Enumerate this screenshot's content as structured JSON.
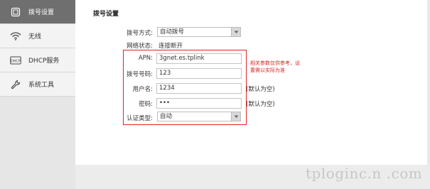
{
  "sidebar": {
    "items": [
      {
        "label": "拨号设置",
        "icon": "router-icon"
      },
      {
        "label": "无线",
        "icon": "wifi-icon"
      },
      {
        "label": "DHCP服务",
        "icon": "dhcp-icon"
      },
      {
        "label": "系统工具",
        "icon": "wrench-icon"
      }
    ],
    "active_index": 0
  },
  "main": {
    "title": "拨号设置",
    "dial_mode": {
      "label": "拨号方式:",
      "value": "自动拨号"
    },
    "network_status": {
      "label": "网络状态:",
      "value": "连接断开"
    },
    "apn": {
      "label": "APN:",
      "value": "3gnet.es.tplink"
    },
    "dial_number": {
      "label": "拨号号码:",
      "value": "123"
    },
    "username": {
      "label": "用户名:",
      "value": "1234",
      "hint": "(默认为空)"
    },
    "password": {
      "label": "密码:",
      "value": "•••",
      "hint": "(默认为空)"
    },
    "auth_type": {
      "label": "认证类型:",
      "value": "自动"
    }
  },
  "annotation": {
    "note": "相关参数仅供参考，设置需以实际为准",
    "color": "#dd2222"
  },
  "watermark": "tploginc.n .com",
  "colors": {
    "active_nav": "#6f6f6f",
    "sidebar": "#e9e9e9",
    "highlight_border": "#dd2222"
  }
}
